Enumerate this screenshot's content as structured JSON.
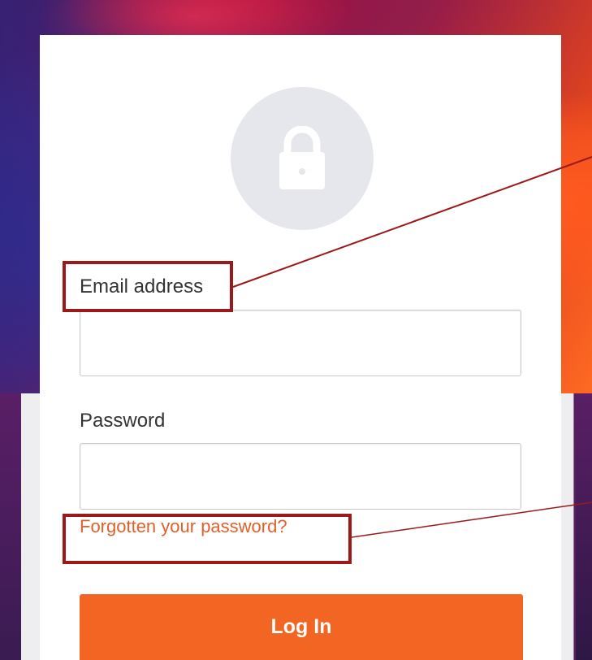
{
  "form": {
    "email_label": "Email address",
    "email_value": "",
    "password_label": "Password",
    "password_value": "",
    "forgot_link": "Forgotten your password?",
    "login_button": "Log In"
  },
  "colors": {
    "accent": "#f26522",
    "link": "#e1602a",
    "highlight": "#9a1a1a",
    "avatar_bg": "#e6e7ec"
  },
  "icons": {
    "avatar": "lock-icon"
  }
}
